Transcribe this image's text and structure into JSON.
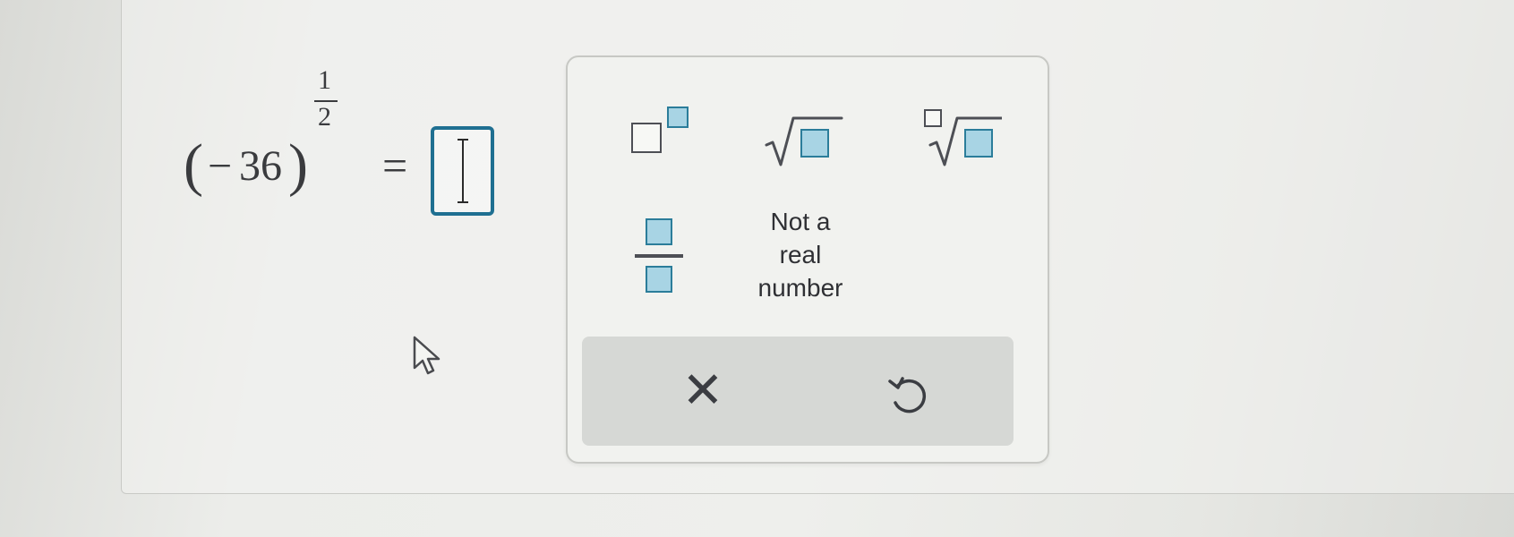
{
  "expression": {
    "open_paren": "(",
    "minus": "−",
    "base": "36",
    "close_paren": ")",
    "exponent_numerator": "1",
    "exponent_denominator": "2",
    "equals": "="
  },
  "answer": {
    "value": ""
  },
  "keypad": {
    "keys": [
      {
        "name": "exponent-key",
        "icon": "superscript-template-icon"
      },
      {
        "name": "square-root-key",
        "icon": "square-root-template-icon"
      },
      {
        "name": "nth-root-key",
        "icon": "nth-root-template-icon"
      },
      {
        "name": "fraction-key",
        "icon": "fraction-template-icon"
      }
    ],
    "not_real_label_line1": "Not a",
    "not_real_label_line2": "real",
    "not_real_label_line3": "number",
    "clear_symbol": "✕",
    "reset_icon": "undo-icon",
    "accent_color": "#1f6f91",
    "template_fill": "#a8d4e4"
  }
}
